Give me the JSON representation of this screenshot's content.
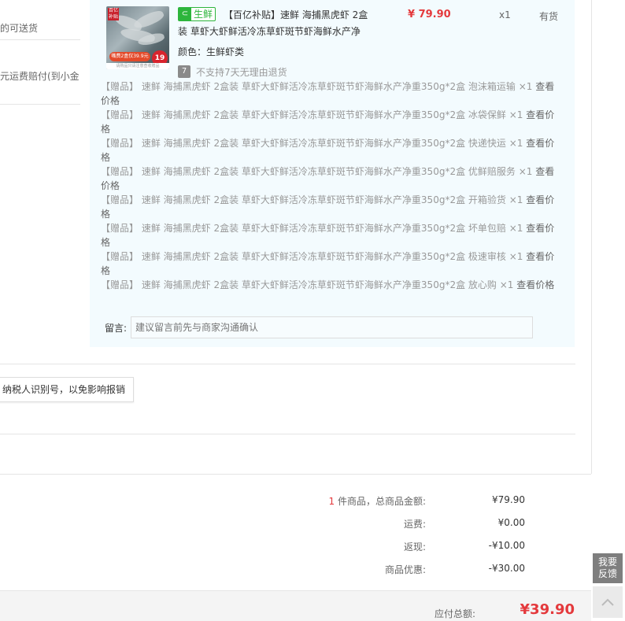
{
  "left_panel": {
    "note1": "的可送货",
    "note2": "元运费赔付(到小金"
  },
  "product": {
    "image": {
      "logo_text": "百亿补贴",
      "banner_text": "嘴费2盒仅39.9元",
      "price_badge": "19",
      "footnote": "请购品只请注意查收赠品"
    },
    "fresh_tag": "生鲜",
    "fresh_icon": "ticket-icon",
    "title": "【百亿补贴】速鲜 海捕黑虎虾 2盒装 草虾大虾鲜活冷冻草虾斑节虾海鲜水产净",
    "price": "¥ 79.90",
    "qty": "x1",
    "stock": "有货",
    "attr_label": "颜色：",
    "attr_value": "生鲜虾类",
    "return_icon": "7",
    "return_text": "不支持7天无理由退货"
  },
  "gifts": [
    {
      "tag": "【赠品】",
      "name": "速鲜 海捕黑虎虾 2盒装 草虾大虾鲜活冷冻草虾斑节虾海鲜水产净重350g*2盒 泡沫箱运输",
      "qty": "×1",
      "view": "查看价格"
    },
    {
      "tag": "【赠品】",
      "name": "速鲜 海捕黑虎虾 2盒装 草虾大虾鲜活冷冻草虾斑节虾海鲜水产净重350g*2盒 冰袋保鲜",
      "qty": "×1",
      "view": "查看价格"
    },
    {
      "tag": "【赠品】",
      "name": "速鲜 海捕黑虎虾 2盒装 草虾大虾鲜活冷冻草虾斑节虾海鲜水产净重350g*2盒 快递快运",
      "qty": "×1",
      "view": "查看价格"
    },
    {
      "tag": "【赠品】",
      "name": "速鲜 海捕黑虎虾 2盒装 草虾大虾鲜活冷冻草虾斑节虾海鲜水产净重350g*2盒 优鲜赔服务",
      "qty": "×1",
      "view": "查看价格"
    },
    {
      "tag": "【赠品】",
      "name": "速鲜 海捕黑虎虾 2盒装 草虾大虾鲜活冷冻草虾斑节虾海鲜水产净重350g*2盒 开箱验货",
      "qty": "×1",
      "view": "查看价格"
    },
    {
      "tag": "【赠品】",
      "name": "速鲜 海捕黑虎虾 2盒装 草虾大虾鲜活冷冻草虾斑节虾海鲜水产净重350g*2盒 坏单包赔",
      "qty": "×1",
      "view": "查看价格"
    },
    {
      "tag": "【赠品】",
      "name": "速鲜 海捕黑虎虾 2盒装 草虾大虾鲜活冷冻草虾斑节虾海鲜水产净重350g*2盒 极速审核",
      "qty": "×1",
      "view": "查看价格"
    },
    {
      "tag": "【赠品】",
      "name": "速鲜 海捕黑虎虾 2盒装 草虾大虾鲜活冷冻草虾斑节虾海鲜水产净重350g*2盒 放心购",
      "qty": "×1",
      "view": "查看价格"
    }
  ],
  "message": {
    "label": "留言:",
    "placeholder": "建议留言前先与商家沟通确认"
  },
  "invoice": {
    "tip": "纳税人识别号，以免影响报销"
  },
  "summary": {
    "count": "1",
    "count_suffix": " 件商品，总商品金额:",
    "goods_total": "¥79.90",
    "shipping_label": "运费:",
    "shipping": "¥0.00",
    "cashback_label": "返现:",
    "cashback": "-¥10.00",
    "discount_label": "商品优惠:",
    "discount": "-¥30.00",
    "payable_label": "应付总额:",
    "payable": "¥39.90"
  },
  "side_tools": {
    "feedback": "我要反馈",
    "to_top_icon": "chevron-up-icon"
  },
  "colors": {
    "accent_red": "#e4393c",
    "fresh_green": "#2db53c",
    "panel_bg": "#f3fbfe"
  }
}
